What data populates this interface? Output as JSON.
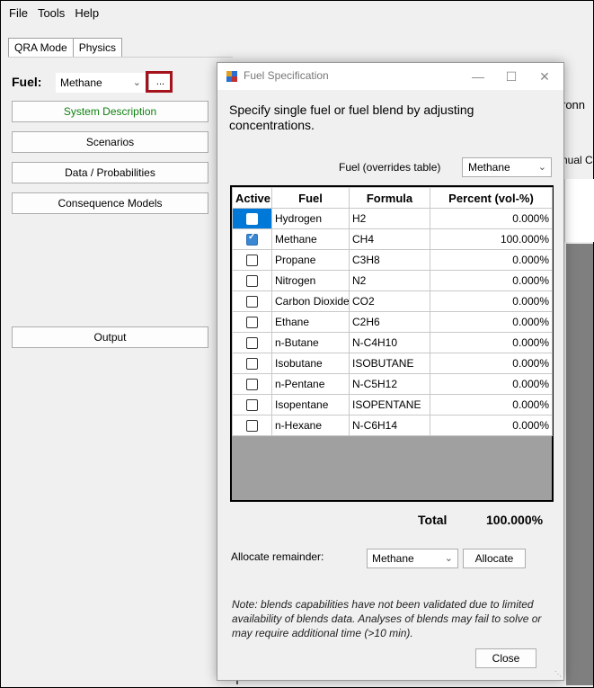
{
  "menu": [
    "File",
    "Tools",
    "Help"
  ],
  "tabs": [
    {
      "label": "QRA Mode",
      "active": true
    },
    {
      "label": "Physics",
      "active": false
    }
  ],
  "left": {
    "fuel_label": "Fuel:",
    "fuel_value": "Methane",
    "dots_label": "...",
    "buttons": [
      "System Description",
      "Scenarios",
      "Data / Probabilities",
      "Consequence Models",
      "Output"
    ]
  },
  "background": {
    "text1": "ronn",
    "text2": "nual C"
  },
  "dialog": {
    "title": "Fuel Specification",
    "intro": "Specify single fuel or fuel blend by adjusting concentrations.",
    "override_label": "Fuel (overrides table)",
    "override_value": "Methane",
    "columns": [
      "Active",
      "Fuel",
      "Formula",
      "Percent (vol-%)"
    ],
    "rows": [
      {
        "active": false,
        "fuel": "Hydrogen",
        "formula": "H2",
        "percent": "0.000%"
      },
      {
        "active": true,
        "fuel": "Methane",
        "formula": "CH4",
        "percent": "100.000%"
      },
      {
        "active": false,
        "fuel": "Propane",
        "formula": "C3H8",
        "percent": "0.000%"
      },
      {
        "active": false,
        "fuel": "Nitrogen",
        "formula": "N2",
        "percent": "0.000%"
      },
      {
        "active": false,
        "fuel": "Carbon Dioxide",
        "formula": "CO2",
        "percent": "0.000%"
      },
      {
        "active": false,
        "fuel": "Ethane",
        "formula": "C2H6",
        "percent": "0.000%"
      },
      {
        "active": false,
        "fuel": "n-Butane",
        "formula": "N-C4H10",
        "percent": "0.000%"
      },
      {
        "active": false,
        "fuel": "Isobutane",
        "formula": "ISOBUTANE",
        "percent": "0.000%"
      },
      {
        "active": false,
        "fuel": "n-Pentane",
        "formula": "N-C5H12",
        "percent": "0.000%"
      },
      {
        "active": false,
        "fuel": "Isopentane",
        "formula": "ISOPENTANE",
        "percent": "0.000%"
      },
      {
        "active": false,
        "fuel": "n-Hexane",
        "formula": "N-C6H14",
        "percent": "0.000%"
      }
    ],
    "total_label": "Total",
    "total_value": "100.000%",
    "allocate_label": "Allocate remainder:",
    "allocate_value": "Methane",
    "allocate_button": "Allocate",
    "note": "Note: blends capabilities have not been validated due to limited availability of blends data. Analyses of blends may fail to solve or may require additional time (>10 min).",
    "close_button": "Close"
  },
  "colors": {
    "highlight": "#a4121b",
    "selection": "#0078d7",
    "green_text": "#108010"
  }
}
